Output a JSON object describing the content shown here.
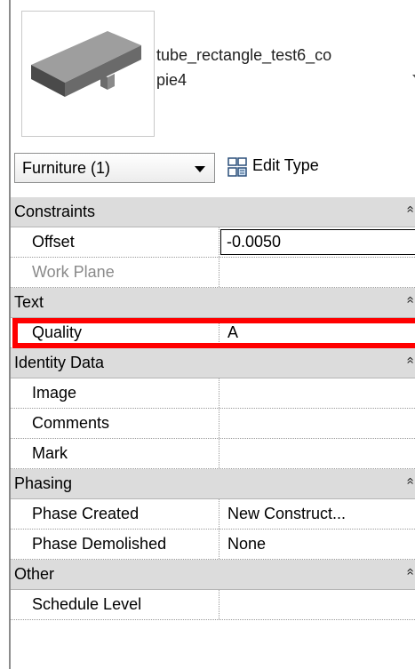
{
  "type_selector": {
    "name_line1": "tube_rectangle_test6_co",
    "name_line2": "pie4"
  },
  "instance_filter": {
    "label": "Furniture (1)",
    "edit_type_label": "Edit Type"
  },
  "groups": {
    "constraints": "Constraints",
    "text": "Text",
    "identity": "Identity Data",
    "phasing": "Phasing",
    "other": "Other"
  },
  "collapse_glyph": "»",
  "props": {
    "offset": {
      "name": "Offset",
      "value": "-0.0050"
    },
    "work_plane": {
      "name": "Work Plane",
      "value": ""
    },
    "quality": {
      "name": "Quality",
      "value": "A"
    },
    "image": {
      "name": "Image",
      "value": ""
    },
    "comments": {
      "name": "Comments",
      "value": ""
    },
    "mark": {
      "name": "Mark",
      "value": ""
    },
    "phase_created": {
      "name": "Phase Created",
      "value": "New Construct..."
    },
    "phase_demolished": {
      "name": "Phase Demolished",
      "value": "None"
    },
    "schedule_level": {
      "name": "Schedule Level",
      "value": ""
    }
  },
  "colors": {
    "group_bg": "#dcdcdc",
    "highlight": "#ff0000"
  }
}
